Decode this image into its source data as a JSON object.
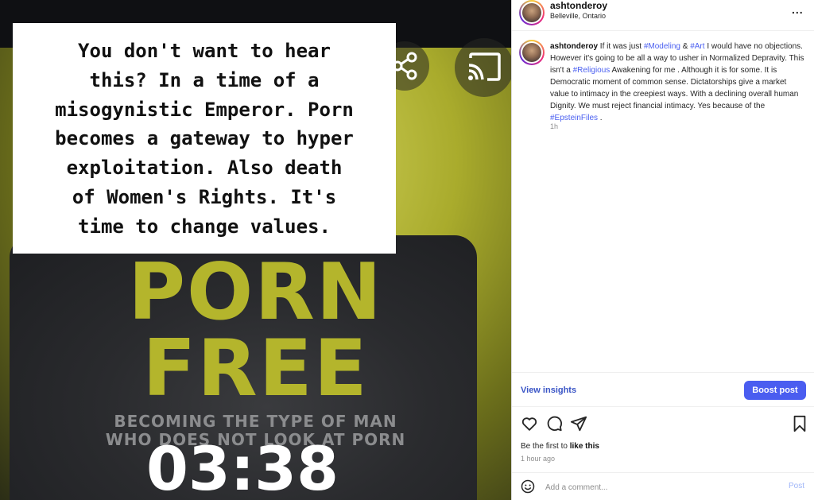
{
  "media": {
    "overlay_text": "You don't want to hear\nthis? In a time of a\nmisogynistic Emperor. Porn\nbecomes a gateway to hyper\nexploitation. Also death\nof Women's Rights. It's\ntime to change values.",
    "book_title_line1": "PORN",
    "book_title_line2": "FREE",
    "book_subtitle_line1": "BECOMING THE TYPE OF MAN",
    "book_subtitle_line2": "WHO DOES NOT LOOK AT PORN",
    "timer": "03:38",
    "share_icon": "share-icon",
    "cast_icon": "cast-icon"
  },
  "post_header": {
    "username": "ashtonderoy",
    "location": "Belleville, Ontario",
    "more": "..."
  },
  "caption": {
    "username": "ashtonderoy",
    "segments": [
      {
        "text": "If it was just ",
        "tag": false
      },
      {
        "text": "#Modeling",
        "tag": true
      },
      {
        "text": " & ",
        "tag": false
      },
      {
        "text": "#Art",
        "tag": true
      },
      {
        "text": " I would have no objections. However it's going to be all a way to usher in Normalized Depravity. This isn't a ",
        "tag": false
      },
      {
        "text": "#Religious",
        "tag": true
      },
      {
        "text": " Awakening for me . Although it is for some. It is Democratic moment of common sense. Dictatorships give a market value to intimacy in the creepiest ways. With a declining overall human Dignity. We must reject financial intimacy. Yes because of the ",
        "tag": false
      },
      {
        "text": "#EpsteinFiles",
        "tag": true
      },
      {
        "text": " .",
        "tag": false
      }
    ],
    "time": "1h"
  },
  "insights": {
    "view_label": "View insights",
    "boost_label": "Boost post",
    "accent_color": "#4a5df0"
  },
  "actions": {
    "icons": [
      "heart-icon",
      "comment-icon",
      "send-icon",
      "bookmark-icon"
    ],
    "likes_prefix": "Be the first to ",
    "likes_link": "like this",
    "time": "1 hour ago"
  },
  "comment": {
    "placeholder": "Add a comment...",
    "post_label": "Post"
  }
}
